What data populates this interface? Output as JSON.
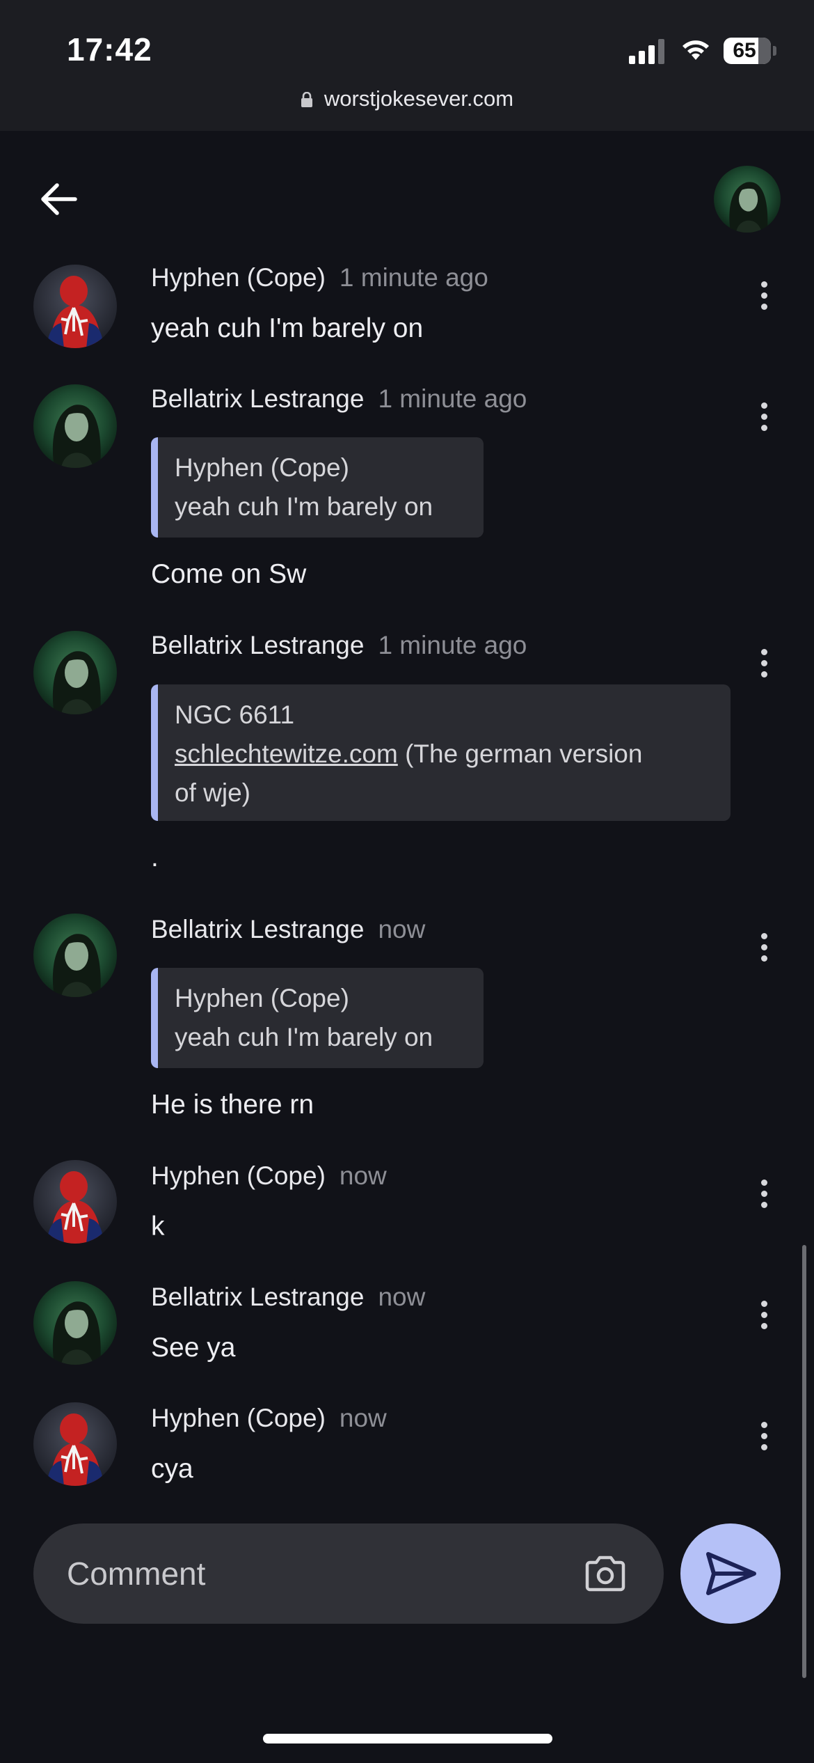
{
  "status_bar": {
    "time": "17:42",
    "battery": "65"
  },
  "browser": {
    "url": "worstjokesever.com"
  },
  "messages": [
    {
      "author": "Hyphen (Cope)",
      "time": "1 minute ago",
      "text": "yeah cuh I'm barely on"
    },
    {
      "author": "Bellatrix Lestrange",
      "time": "1 minute ago",
      "quote": {
        "author": "Hyphen (Cope)",
        "text": "yeah cuh I'm barely on"
      },
      "text": "Come on Sw"
    },
    {
      "author": "Bellatrix Lestrange",
      "time": "1 minute ago",
      "quote": {
        "author": "NGC 6611",
        "link": "schlechtewitze.com",
        "text_after_link": " (The german version",
        "text_line2": "of wje)"
      },
      "text": "."
    },
    {
      "author": "Bellatrix Lestrange",
      "time": "now",
      "quote": {
        "author": "Hyphen (Cope)",
        "text": "yeah cuh I'm barely on"
      },
      "text": "He is there rn"
    },
    {
      "author": "Hyphen (Cope)",
      "time": "now",
      "text": "k"
    },
    {
      "author": "Bellatrix Lestrange",
      "time": "now",
      "text": "See ya"
    },
    {
      "author": "Hyphen (Cope)",
      "time": "now",
      "text": "cya"
    }
  ],
  "composer": {
    "placeholder": "Comment"
  },
  "icons": {
    "back": "arrow-left-icon",
    "more": "more-vertical-icon",
    "camera": "camera-icon",
    "send": "send-icon",
    "lock": "lock-icon"
  },
  "colors": {
    "background": "#111218",
    "quote_accent": "#a9b6f2",
    "send_button": "#b5c1f7"
  }
}
